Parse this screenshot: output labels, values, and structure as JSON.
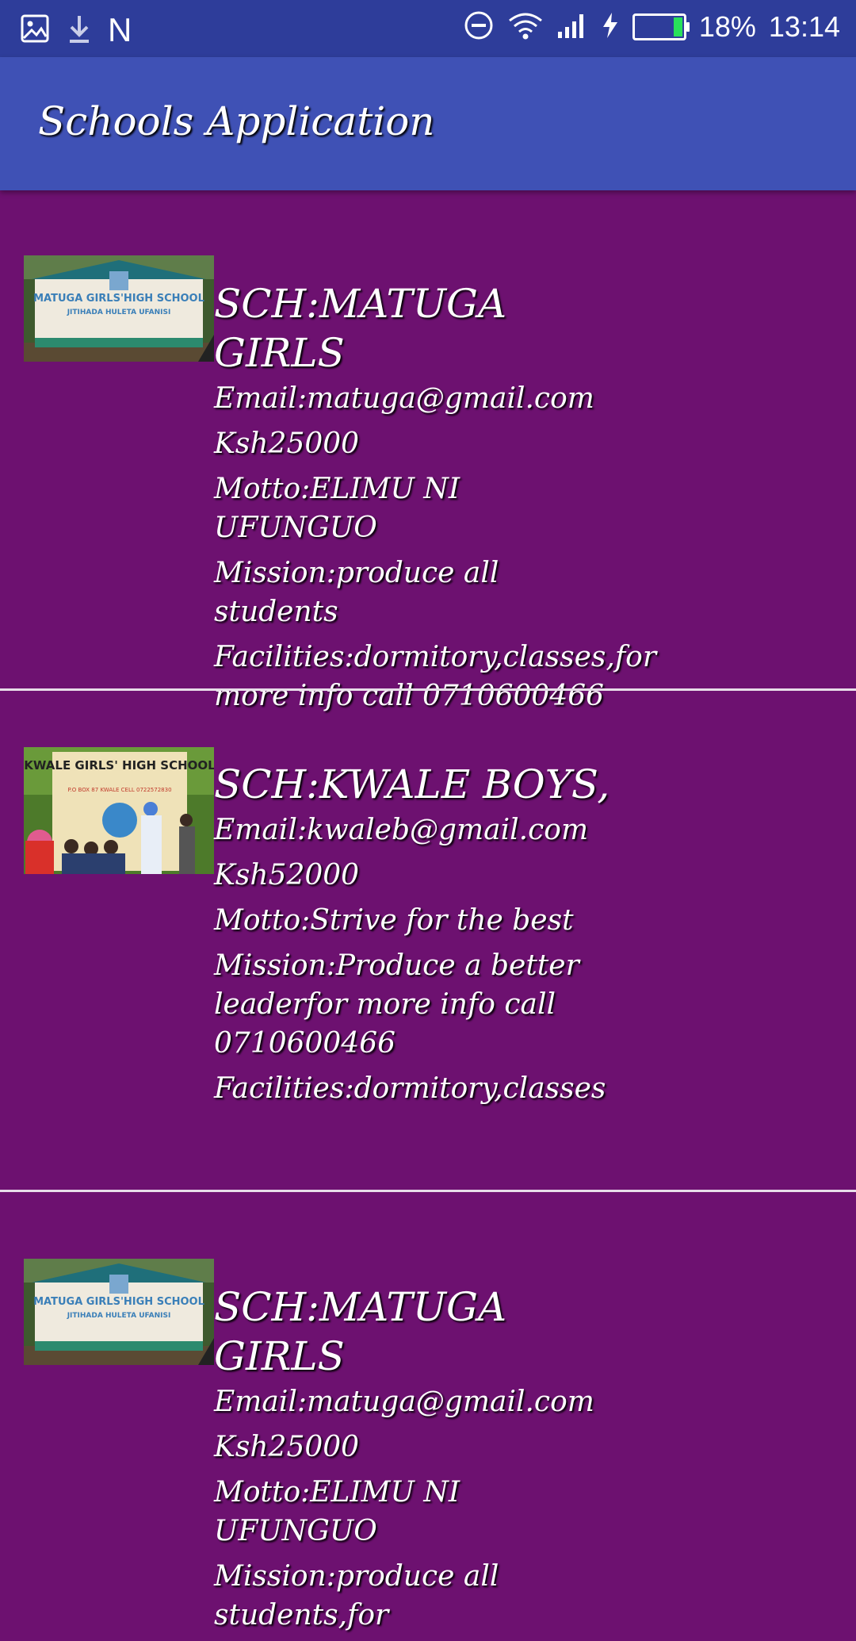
{
  "status_bar": {
    "left_icons": [
      "image-icon",
      "download-icon"
    ],
    "n_label": "N",
    "right_icons": [
      "dnd-icon",
      "wifi-icon",
      "signal-icon",
      "charging-icon",
      "battery-icon"
    ],
    "battery_percent": "18%",
    "time": "13:14",
    "battery_level": 0.18
  },
  "app_bar": {
    "title": "Schools Application"
  },
  "schools": [
    {
      "image_text": [
        "MATUGA GIRLS'HIGH SCHOOL",
        "JITIHADA HULETA UFANISI"
      ],
      "name": "SCH:MATUGA GIRLS",
      "email": "Email:matuga@gmail.com",
      "fee": "Ksh25000",
      "motto": "Motto:ELIMU NI UFUNGUO",
      "mission": "Mission:produce all students",
      "facilities": "Facilities:dormitory,classes,for more info call 0710600466"
    },
    {
      "image_text": [
        "KWALE GIRLS' HIGH SCHOOL",
        "P.O BOX 87 KWALE CELL 0722572830"
      ],
      "name": "SCH:KWALE BOYS,",
      "email": "Email:kwaleb@gmail.com",
      "fee": "Ksh52000",
      "motto": "Motto:Strive for the best",
      "mission": "Mission:Produce a better leaderfor more info call 0710600466",
      "facilities": "Facilities:dormitory,classes"
    },
    {
      "image_text": [
        "MATUGA GIRLS'HIGH SCHOOL",
        "JITIHADA HULETA UFANISI"
      ],
      "name": "SCH:MATUGA GIRLS",
      "email": "Email:matuga@gmail.com",
      "fee": "Ksh25000",
      "motto": "Motto:ELIMU NI UFUNGUO",
      "mission": "Mission:produce all students,for"
    }
  ],
  "colors": {
    "status_bar": "#2e3d9a",
    "app_bar": "#3f51b5",
    "background": "#6d1170",
    "divider": "#e8dde9",
    "text": "#ffffff"
  }
}
